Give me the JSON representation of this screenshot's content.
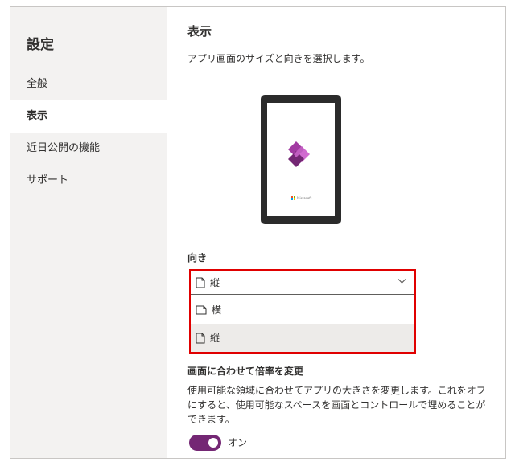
{
  "sidebar": {
    "title": "設定",
    "items": [
      {
        "label": "全般",
        "active": false
      },
      {
        "label": "表示",
        "active": true
      },
      {
        "label": "近日公開の機能",
        "active": false
      },
      {
        "label": "サポート",
        "active": false
      }
    ]
  },
  "main": {
    "title": "表示",
    "description": "アプリ画面のサイズと向きを選択します。",
    "preview": {
      "brand_text": "Microsoft"
    },
    "orientation": {
      "label": "向き",
      "selected": "縦",
      "options": [
        "横",
        "縦"
      ],
      "highlighted_option": "縦"
    },
    "scale_to_fit": {
      "title": "画面に合わせて倍率を変更",
      "description": "使用可能な領域に合わせてアプリの大きさを変更します。これをオフにすると、使用可能なスペースを画面とコントロールで埋めることができます。",
      "toggle_on": true,
      "toggle_label": "オン"
    }
  },
  "colors": {
    "accent": "#742774",
    "highlight_border": "#e00000",
    "sidebar_bg": "#f3f2f1"
  }
}
